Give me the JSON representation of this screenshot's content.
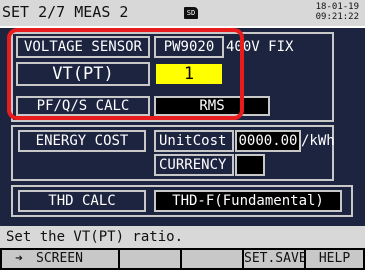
{
  "header": {
    "tab_label": "SET  2/7 MEAS 2",
    "sd_label": "SD",
    "date": "18-01-19",
    "time": "09:21:22"
  },
  "voltage_sensor": {
    "label": "VOLTAGE SENSOR",
    "model": "PW9020",
    "fix": "400V FIX"
  },
  "vt_pt": {
    "label": "VT(PT)",
    "value": "1"
  },
  "pf_calc": {
    "label": "PF/Q/S CALC",
    "value": "RMS"
  },
  "energy_cost": {
    "label": "ENERGY COST",
    "unit_cost_label": "UnitCost",
    "unit_cost_value": "0000.00",
    "unit": "/kWh",
    "currency_label": "CURRENCY",
    "currency_value": ""
  },
  "thd_calc": {
    "label": "THD CALC",
    "value": "THD-F(Fundamental)"
  },
  "status": {
    "message": "Set the VT(PT) ratio."
  },
  "function_keys": {
    "screen": "SCREEN",
    "set_save": "SET.SAVE",
    "help": "HELP"
  },
  "colors": {
    "background": "#1c2440",
    "highlight": "#e81c1c",
    "selected": "#ffff00"
  }
}
